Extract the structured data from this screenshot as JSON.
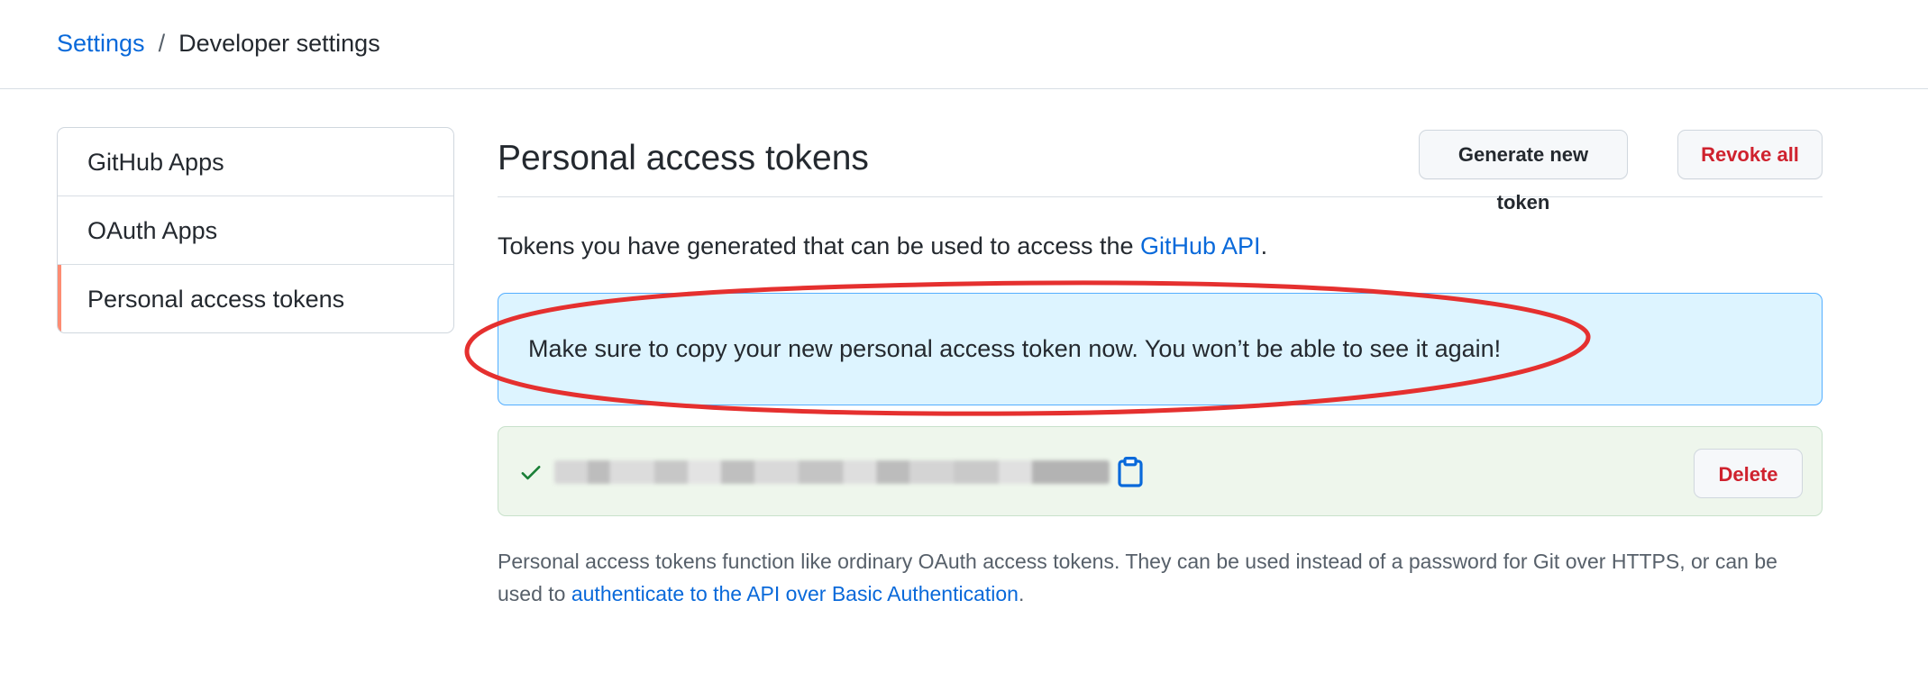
{
  "breadcrumb": {
    "parent": "Settings",
    "separator": "/",
    "current": "Developer settings"
  },
  "sidebar": {
    "items": [
      {
        "label": "GitHub Apps",
        "active": false
      },
      {
        "label": "OAuth Apps",
        "active": false
      },
      {
        "label": "Personal access tokens",
        "active": true
      }
    ]
  },
  "main": {
    "title": "Personal access tokens",
    "generate_label": "Generate new token",
    "revoke_label": "Revoke all",
    "intro_prefix": "Tokens you have generated that can be used to access the ",
    "intro_link": "GitHub API",
    "intro_suffix": ".",
    "flash_message": "Make sure to copy your new personal access token now. You won’t be able to see it again!",
    "token": {
      "value": "",
      "delete_label": "Delete"
    },
    "footnote_prefix": "Personal access tokens function like ordinary OAuth access tokens. They can be used instead of a password for Git over HTTPS, or can be used to ",
    "footnote_link": "authenticate to the API over Basic Authentication",
    "footnote_suffix": "."
  },
  "colors": {
    "link": "#0969da",
    "danger": "#cf222e",
    "flash_bg": "#ddf4ff",
    "flash_border": "#54aeff",
    "success_bg": "#eef6ec",
    "success_icon": "#1a7f37",
    "active_marker": "#fd8c73",
    "annotation": "#e5302f"
  },
  "icons": {
    "token_status": "check-icon",
    "copy": "clipboard-icon"
  }
}
